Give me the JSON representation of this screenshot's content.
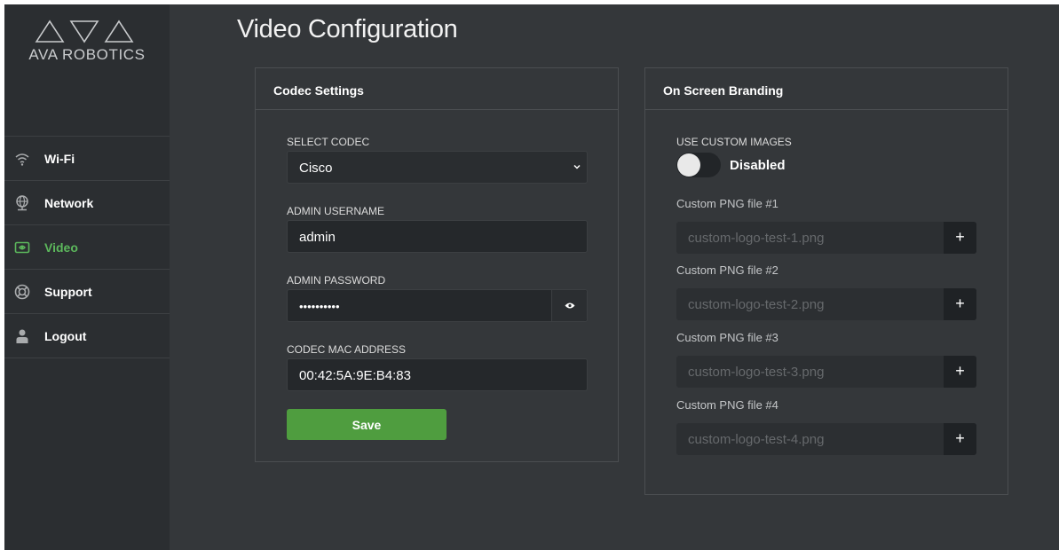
{
  "brand": {
    "name": "AVA ROBOTICS"
  },
  "sidebar": {
    "items": [
      {
        "label": "Wi-Fi",
        "icon": "wifi-icon",
        "active": false
      },
      {
        "label": "Network",
        "icon": "globe-icon",
        "active": false
      },
      {
        "label": "Video",
        "icon": "video-icon",
        "active": true
      },
      {
        "label": "Support",
        "icon": "lifebuoy-icon",
        "active": false
      },
      {
        "label": "Logout",
        "icon": "user-icon",
        "active": false
      }
    ]
  },
  "page": {
    "title": "Video Configuration"
  },
  "codec": {
    "header": "Codec Settings",
    "select_label": "SELECT CODEC",
    "select_value": "Cisco",
    "username_label": "ADMIN USERNAME",
    "username_value": "admin",
    "password_label": "ADMIN PASSWORD",
    "password_value": "••••••••••",
    "mac_label": "CODEC MAC ADDRESS",
    "mac_value": "00:42:5A:9E:B4:83",
    "save_label": "Save"
  },
  "branding": {
    "header": "On Screen Branding",
    "toggle_label": "USE CUSTOM IMAGES",
    "toggle_state": "Disabled",
    "files": [
      {
        "label": "Custom PNG file #1",
        "placeholder": "custom-logo-test-1.png",
        "button": "+"
      },
      {
        "label": "Custom PNG file #2",
        "placeholder": "custom-logo-test-2.png",
        "button": "+"
      },
      {
        "label": "Custom PNG file #3",
        "placeholder": "custom-logo-test-3.png",
        "button": "+"
      }
    ],
    "file4": {
      "label": "Custom PNG file #4",
      "placeholder": "custom-logo-test-4.png",
      "button": "+"
    }
  },
  "colors": {
    "accent_green": "#5cb85c",
    "save_button": "#4f9d3f",
    "sidebar_bg": "#2b2e31",
    "content_bg": "#34373a"
  }
}
